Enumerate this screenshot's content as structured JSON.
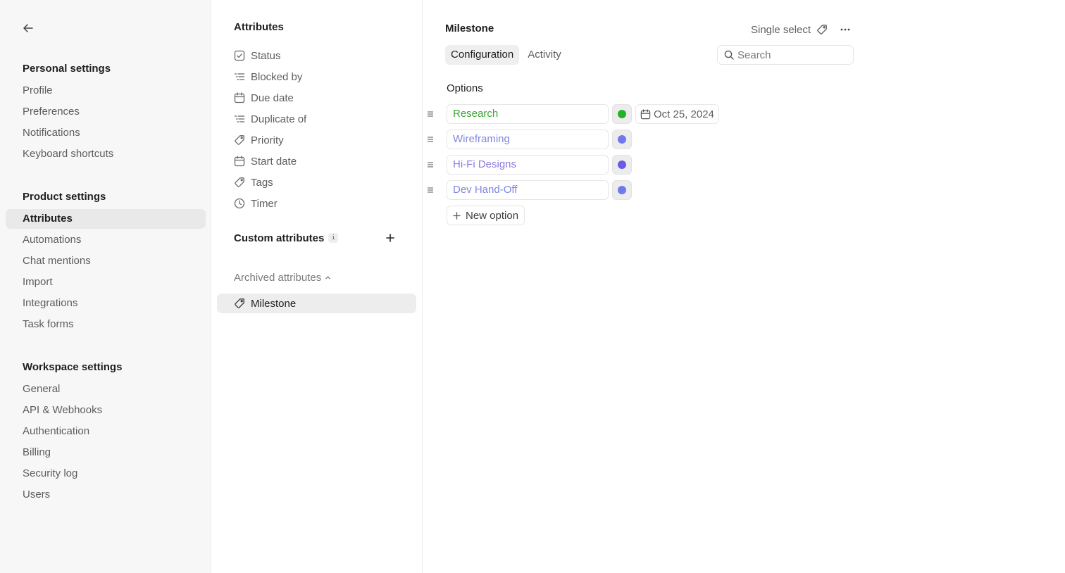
{
  "sidebar": {
    "personal": {
      "heading": "Personal settings",
      "items": [
        "Profile",
        "Preferences",
        "Notifications",
        "Keyboard shortcuts"
      ]
    },
    "product": {
      "heading": "Product settings",
      "items": [
        "Attributes",
        "Automations",
        "Chat mentions",
        "Import",
        "Integrations",
        "Task forms"
      ],
      "active": "Attributes"
    },
    "workspace": {
      "heading": "Workspace settings",
      "items": [
        "General",
        "API & Webhooks",
        "Authentication",
        "Billing",
        "Security log",
        "Users"
      ]
    }
  },
  "attributes": {
    "heading": "Attributes",
    "items": [
      {
        "label": "Status",
        "icon": "checkbox-icon"
      },
      {
        "label": "Blocked by",
        "icon": "dependency-list-icon"
      },
      {
        "label": "Due date",
        "icon": "calendar-icon"
      },
      {
        "label": "Duplicate of",
        "icon": "dependency-list-icon"
      },
      {
        "label": "Priority",
        "icon": "tag-icon"
      },
      {
        "label": "Start date",
        "icon": "calendar-icon"
      },
      {
        "label": "Tags",
        "icon": "tag-icon"
      },
      {
        "label": "Timer",
        "icon": "clock-icon"
      }
    ],
    "custom_label": "Custom attributes",
    "info_badge": "i",
    "archived_label": "Archived attributes",
    "archived_items": [
      {
        "label": "Milestone",
        "icon": "tag-icon"
      }
    ]
  },
  "detail": {
    "title": "Milestone",
    "type_label": "Single select",
    "tabs": [
      "Configuration",
      "Activity"
    ],
    "active_tab": "Configuration",
    "search": {
      "placeholder": "Search",
      "value": ""
    },
    "options_label": "Options",
    "options": [
      {
        "name": "Research",
        "text_color": "#3aa632",
        "dot_color": "#22b32a",
        "date": "Oct 25, 2024"
      },
      {
        "name": "Wireframing",
        "text_color": "#7f86e0",
        "dot_color": "#7177ee",
        "date": ""
      },
      {
        "name": "Hi-Fi Designs",
        "text_color": "#8f79de",
        "dot_color": "#6b5be8",
        "date": ""
      },
      {
        "name": "Dev Hand-Off",
        "text_color": "#7f86e0",
        "dot_color": "#7177ee",
        "date": ""
      }
    ],
    "new_option_label": "New option"
  }
}
